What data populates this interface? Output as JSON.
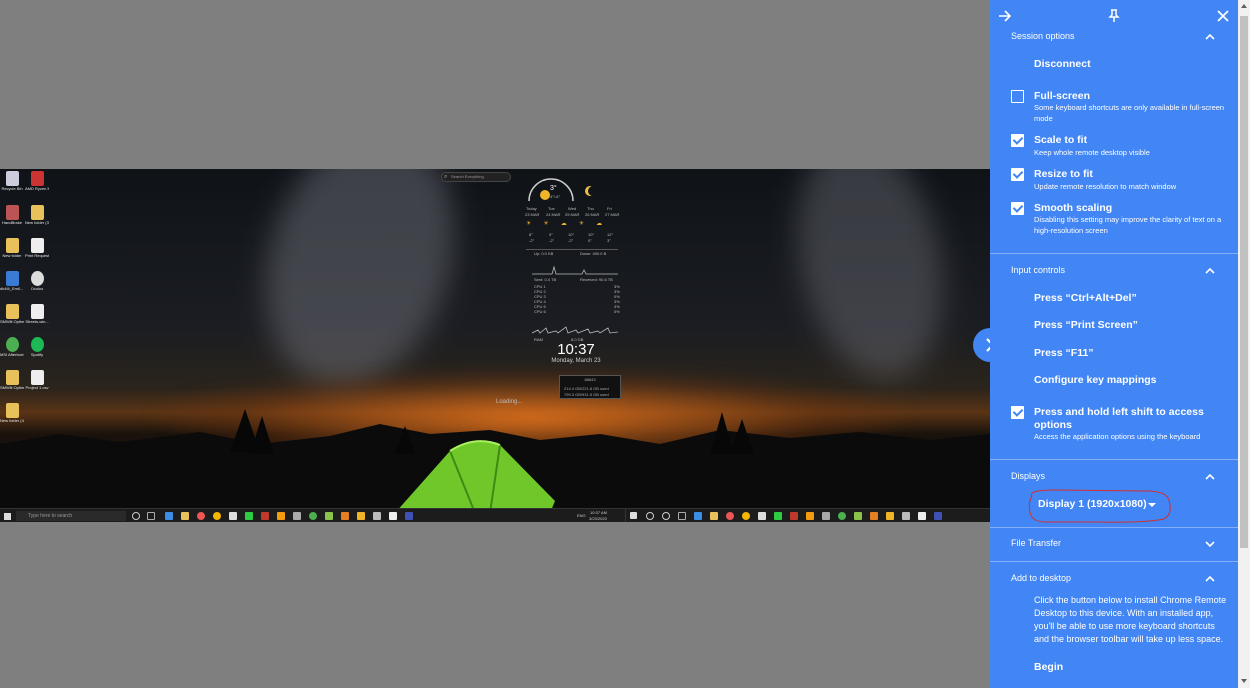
{
  "panel": {
    "header": {
      "collapse_icon": "arrow-right-icon",
      "pin_icon": "pin-icon",
      "close_icon": "close-icon"
    },
    "session": {
      "heading": "Session options",
      "disconnect": "Disconnect",
      "options": [
        {
          "title": "Full-screen",
          "desc": "Some keyboard shortcuts are only available in full-screen mode",
          "checked": false
        },
        {
          "title": "Scale to fit",
          "desc": "Keep whole remote desktop visible",
          "checked": true
        },
        {
          "title": "Resize to fit",
          "desc": "Update remote resolution to match window",
          "checked": true
        },
        {
          "title": "Smooth scaling",
          "desc": "Disabling this setting may improve the clarity of text on a high-resolution screen",
          "checked": true
        }
      ]
    },
    "input": {
      "heading": "Input controls",
      "actions": [
        "Press “Ctrl+Alt+Del”",
        "Press “Print Screen”",
        "Press “F11”",
        "Configure key mappings"
      ],
      "shift_title": "Press and hold left shift to access options",
      "shift_desc": "Access the application options using the keyboard",
      "shift_checked": true
    },
    "displays": {
      "heading": "Displays",
      "selected": "Display 1 (1920x1080)"
    },
    "file_transfer": {
      "heading": "File Transfer"
    },
    "add_to_desktop": {
      "heading": "Add to desktop",
      "body": "Click the button below to install Chrome Remote Desktop to this device. With an installed app, you'll be able to use more keyboard shortcuts and the browser toolbar will take up less space.",
      "begin": "Begin"
    },
    "accent": "#4285f4"
  },
  "remote": {
    "desktop_icons": [
      "Recycle Bin",
      "AMD Ryzen Master",
      "HandBrake",
      "New folder (3)",
      "New folder",
      "Print Request.pdf",
      "dk4f4_Emil... - Shortcut",
      "Oculus",
      "SMWiii Optim...",
      "Streets-win...",
      "MSI Afterburner",
      "Spotify",
      "SMWiii Optim...",
      "Project 1.csv",
      "New folder (4)"
    ],
    "search_placeholder": "Search Everything",
    "weather": {
      "current_temp": "3°",
      "current_range": "4°/-6°",
      "days": [
        {
          "name": "Today",
          "date": "23 MAR",
          "hi": "8°",
          "lo": "-2°"
        },
        {
          "name": "Tue",
          "date": "24 MAR",
          "hi": "9°",
          "lo": "-2°"
        },
        {
          "name": "Wed",
          "date": "25 MAR",
          "hi": "10°",
          "lo": "-2°"
        },
        {
          "name": "Thu",
          "date": "26 MAR",
          "hi": "10°",
          "lo": "0°"
        },
        {
          "name": "Fri",
          "date": "27 MAR",
          "hi": "12°",
          "lo": "3°"
        }
      ]
    },
    "net": {
      "up": "Up: 0.0 KB",
      "down": "Down: 490.0 B",
      "sent": "Sent: 0.4 TB",
      "received": "Received: 90.6 TB"
    },
    "cpus": [
      {
        "label": "CPU 1",
        "value": "3%"
      },
      {
        "label": "CPU 2",
        "value": "3%"
      },
      {
        "label": "CPU 3",
        "value": "0%"
      },
      {
        "label": "CPU 4",
        "value": "3%"
      },
      {
        "label": "CPU 5",
        "value": "3%"
      },
      {
        "label": "CPU 6",
        "value": "0%"
      }
    ],
    "ram_label": "RAM",
    "ram_value": "8.0 GB",
    "clock": "10:37",
    "date": "Monday, March 23",
    "loading": "Loading...",
    "perf": {
      "title": "88843",
      "c": "214.4 GB/221.8 GB used",
      "d": "799.3 GB/931.5 GB used"
    },
    "taskbar": {
      "search": "Type here to search",
      "lang": "ENG",
      "time": "10:37 AM",
      "date": "3/23/2020"
    }
  }
}
